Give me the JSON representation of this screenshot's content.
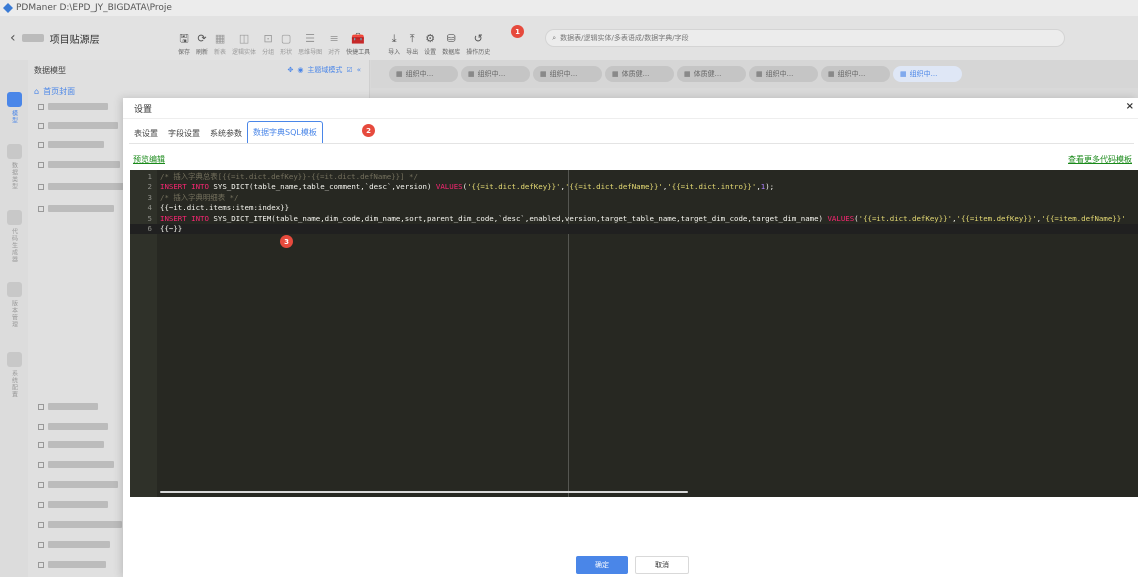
{
  "window": {
    "title": "PDManer   D:\\EPD_JY_BIGDATA\\Proje"
  },
  "appbar": {
    "project_name": "项目贴源层"
  },
  "toolbar": [
    {
      "label": "保存",
      "icon": "save-icon",
      "glyph": "🖫"
    },
    {
      "label": "刷新",
      "icon": "refresh-icon",
      "glyph": "⟳"
    },
    {
      "label": "新表",
      "icon": "new-table-icon",
      "glyph": "▦",
      "dim": true
    },
    {
      "label": "逻辑实体",
      "icon": "entity-icon",
      "glyph": "◫",
      "dim": true
    },
    {
      "label": "分组",
      "icon": "group-icon",
      "glyph": "⊡",
      "dim": true
    },
    {
      "label": "形状",
      "icon": "shape-icon",
      "glyph": "▢",
      "dim": true
    },
    {
      "label": "思维导图",
      "icon": "mindmap-icon",
      "glyph": "☰",
      "dim": true
    },
    {
      "label": "对齐",
      "icon": "align-icon",
      "glyph": "≡",
      "dim": true
    },
    {
      "label": "快捷工具",
      "icon": "toolbox-icon",
      "glyph": "🧰"
    },
    {
      "label": "导入",
      "icon": "import-icon",
      "glyph": "⤓"
    },
    {
      "label": "导出",
      "icon": "export-icon",
      "glyph": "⤒"
    },
    {
      "label": "设置",
      "icon": "gear-icon",
      "glyph": "⚙"
    },
    {
      "label": "数据库",
      "icon": "database-icon",
      "glyph": "⛁"
    },
    {
      "label": "操作历史",
      "icon": "history-icon",
      "glyph": "↺"
    }
  ],
  "search": {
    "placeholder": "数据表/逻辑实体/多表语成/数据字典/字段"
  },
  "left_rail": [
    {
      "label": "模型",
      "icon": "model-icon",
      "active": true
    },
    {
      "label": "数据类型",
      "icon": "datatype-icon"
    },
    {
      "label": "代码生成器",
      "icon": "codegen-icon"
    },
    {
      "label": "版本管理",
      "icon": "version-icon"
    },
    {
      "label": "系统配置",
      "icon": "sysconfig-icon"
    }
  ],
  "tree": {
    "header": "数据模型",
    "mode_label": "主题域模式",
    "home": "首页封面"
  },
  "file_tabs": [
    {
      "label": "组织中..."
    },
    {
      "label": "组织中..."
    },
    {
      "label": "组织中..."
    },
    {
      "label": "体质健..."
    },
    {
      "label": "体质健..."
    },
    {
      "label": "组织中..."
    },
    {
      "label": "组织中..."
    },
    {
      "label": "组织中...",
      "active": true
    }
  ],
  "modal": {
    "title": "设置",
    "close_glyph": "×",
    "tabs": [
      "表设置",
      "字段设置",
      "系统参数",
      "数据字典SQL模板"
    ],
    "active_tab": 3,
    "preview_link": "预览编辑",
    "more_templates_link": "查看更多代码模板",
    "ok_label": "确定",
    "cancel_label": "取消",
    "badges": [
      "1",
      "2",
      "3"
    ]
  },
  "editor": {
    "lines": [
      {
        "n": "1",
        "text": "/* 插入字典总表[{{=it.dict.defKey}}-{{=it.dict.defName}}] */"
      },
      {
        "n": "2",
        "text": "INSERT INTO SYS_DICT(table_name,table_comment,`desc`,version) VALUES('{{=it.dict.defKey}}','{{=it.dict.defName}}','{{=it.dict.intro}}',1);"
      },
      {
        "n": "3",
        "text": "/* 插入字典明细表 */"
      },
      {
        "n": "4",
        "text": "{{~it.dict.items:item:index}}"
      },
      {
        "n": "5",
        "text": "INSERT INTO SYS_DICT_ITEM(table_name,dim_code,dim_name,sort,parent_dim_code,`desc`,enabled,version,target_table_name,target_dim_code,target_dim_name) VALUES('{{=it.dict.defKey}}','{{=item.defKey}}','{{=item.defName}}'"
      },
      {
        "n": "6",
        "text": "{{~}}"
      }
    ]
  },
  "colors": {
    "accent": "#4a86e8",
    "badge": "#e64a3d",
    "link": "#1a8a1a",
    "editor_bg": "#272822"
  }
}
